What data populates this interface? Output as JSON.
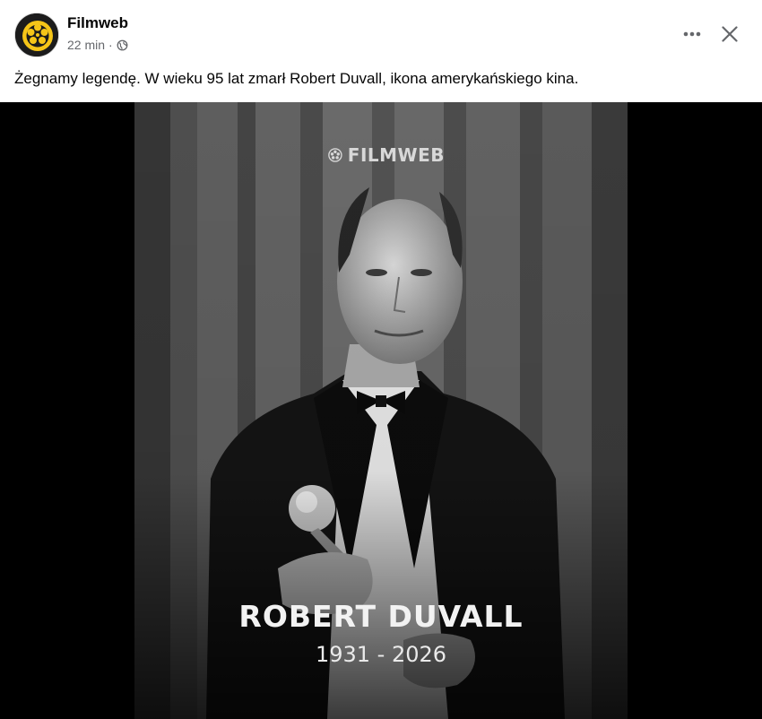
{
  "post": {
    "page_name": "Filmweb",
    "timestamp": "22 min",
    "separator": "·",
    "privacy_icon": "globe-icon",
    "caption": "Żegnamy legendę. W wieku 95 lat zmarł Robert Duvall, ikona amerykańskiego kina."
  },
  "actions": {
    "more_icon": "more-horizontal-icon",
    "close_icon": "close-icon"
  },
  "image": {
    "watermark": "FILMWEB",
    "name": "ROBERT DUVALL",
    "years": "1931 - 2026"
  },
  "colors": {
    "brand_yellow": "#f5c518",
    "text_primary": "#050505",
    "text_secondary": "#65676b",
    "media_background": "#000000"
  }
}
